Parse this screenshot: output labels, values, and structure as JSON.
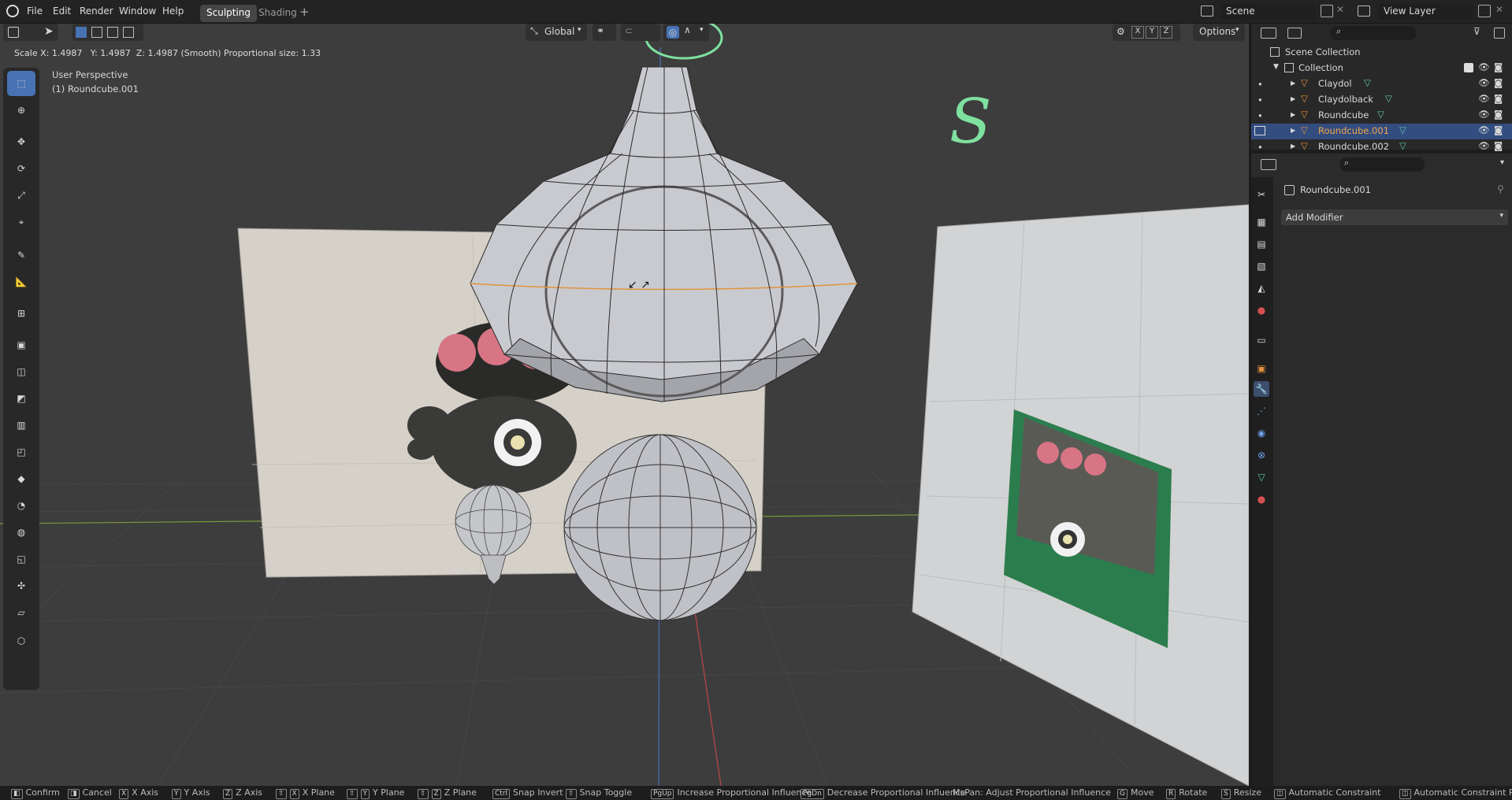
{
  "menu": {
    "file": "File",
    "edit": "Edit",
    "render": "Render",
    "window": "Window",
    "help": "Help"
  },
  "workspace_tabs": [
    "Sculpting",
    "Shading"
  ],
  "scene": {
    "label": "Scene",
    "view_layer": "View Layer"
  },
  "viewport": {
    "transform_orientation": "Global",
    "options": "Options",
    "axes": [
      "X",
      "Y",
      "Z"
    ],
    "header_info": "Scale X: 1.4987   Y: 1.4987  Z: 1.4987 (Smooth) Proportional size: 1.33",
    "view_name": "User Perspective",
    "object_label": "(1) Roundcube.001",
    "annotation_letter": "S"
  },
  "outliner": {
    "scene_collection": "Scene Collection",
    "collection": "Collection",
    "items": [
      "Claydol",
      "Claydolback",
      "Roundcube",
      "Roundcube.001",
      "Roundcube.002"
    ],
    "selected_index": 3
  },
  "properties": {
    "object_name": "Roundcube.001",
    "add_modifier": "Add Modifier"
  },
  "status": {
    "confirm": "Confirm",
    "cancel": "Cancel",
    "x_axis": "X Axis",
    "y_axis": "Y Axis",
    "z_axis": "Z Axis",
    "x_plane": "X Plane",
    "y_plane": "Y Plane",
    "z_plane": "Z Plane",
    "snap_invert": "Snap Invert",
    "snap_toggle": "Snap Toggle",
    "inc_prop": "Increase Proportional Influence",
    "dec_prop": "Decrease Proportional Influence",
    "mspan": "MsPan: Adjust Proportional Influence",
    "move": "Move",
    "rotate": "Rotate",
    "resize": "Resize",
    "auto_constraint": "Automatic Constraint",
    "auto_constraint_p": "Automatic Constraint Pl",
    "keys": {
      "ctrl": "Ctrl",
      "pgup": "PgUp",
      "pgdn": "PgDn",
      "g": "G",
      "r": "R",
      "s": "S",
      "x": "X",
      "y": "Y",
      "z": "Z"
    }
  },
  "colors": {
    "accent": "#4772b3",
    "selected_row": "#334d80",
    "object_orange": "#e2923d",
    "annotation_green": "#7fe0a0",
    "axis_red": "#c04848",
    "axis_green": "#7a9a3a",
    "axis_blue": "#4a6fb8"
  }
}
